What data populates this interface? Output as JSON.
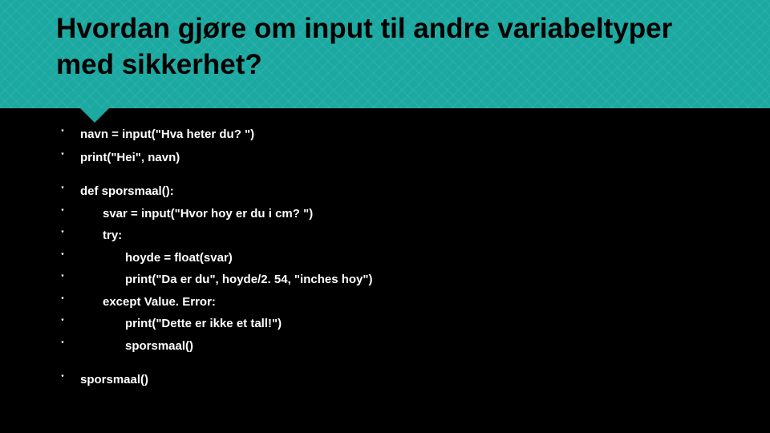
{
  "header": {
    "title": "Hvordan gjøre om input til andre variabeltyper med sikkerhet?"
  },
  "bullet": "་",
  "lines": {
    "l0": "navn = input(\"Hva heter du? \")",
    "l1": "print(\"Hei\", navn)",
    "l2": "def sporsmaal():",
    "l3": "svar = input(\"Hvor hoy er du i cm? \")",
    "l4": "try:",
    "l5": "hoyde = float(svar)",
    "l6": "print(\"Da er du\", hoyde/2. 54, \"inches hoy\")",
    "l7": "except Value. Error:",
    "l8": "print(\"Dette er ikke et tall!\")",
    "l9": "sporsmaal()",
    "l10": "sporsmaal()"
  }
}
